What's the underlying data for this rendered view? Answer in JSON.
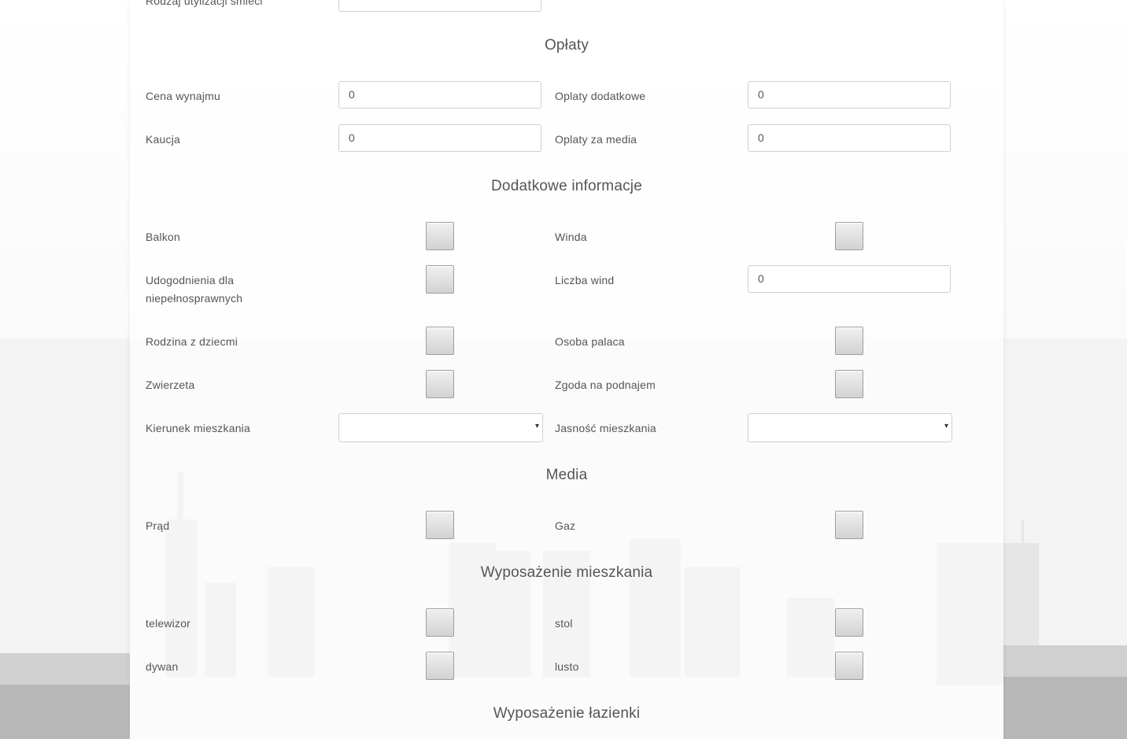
{
  "form": {
    "top_cut_label": "Rodzaj utylizacji śmieci",
    "sections": {
      "fees": "Opłaty",
      "additional": "Dodatkowe informacje",
      "media": "Media",
      "equipment": "Wyposażenie mieszkania",
      "bathroom": "Wyposażenie łazienki"
    },
    "fields": {
      "rent_price": {
        "label": "Cena wynajmu",
        "value": "0"
      },
      "extra_fees": {
        "label": "Oplaty dodatkowe",
        "value": "0"
      },
      "deposit": {
        "label": "Kaucja",
        "value": "0"
      },
      "media_fees": {
        "label": "Oplaty za media",
        "value": "0"
      },
      "balcony": {
        "label": "Balkon"
      },
      "elevator": {
        "label": "Winda"
      },
      "accessibility": {
        "label_line1": "Udogodnienia dla",
        "label_line2": "niepełnosprawnych"
      },
      "elevator_count": {
        "label": "Liczba wind",
        "value": "0"
      },
      "family_kids": {
        "label": "Rodzina z dziecmi"
      },
      "smoker": {
        "label": "Osoba palaca"
      },
      "pets": {
        "label": "Zwierzeta"
      },
      "sublet": {
        "label": "Zgoda na podnajem"
      },
      "direction": {
        "label": "Kierunek mieszkania",
        "value": ""
      },
      "brightness": {
        "label": "Jasność mieszkania",
        "value": ""
      },
      "electricity": {
        "label": "Prąd"
      },
      "gas": {
        "label": "Gaz"
      },
      "tv": {
        "label": "telewizor"
      },
      "table": {
        "label": "stol"
      },
      "carpet": {
        "label": "dywan"
      },
      "mirror": {
        "label": "lusto"
      }
    }
  },
  "icons": {
    "select_arrow": "▾"
  },
  "colors": {
    "text": "#555555",
    "border": "#cfcfcf",
    "checkbox_border": "#9e9e9e"
  }
}
